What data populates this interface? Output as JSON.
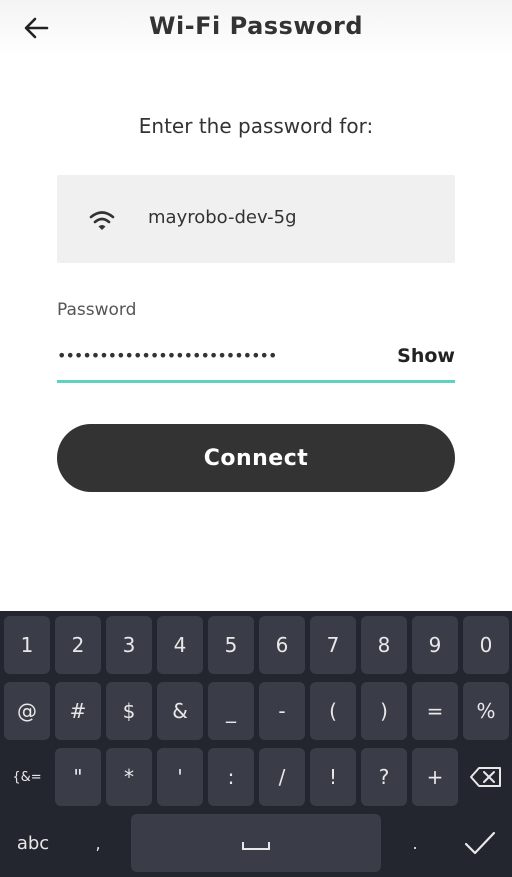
{
  "header": {
    "back_label": "←",
    "title": "Wi-Fi Password"
  },
  "main": {
    "prompt": "Enter the password for:",
    "network": {
      "ssid": "mayrobo-dev-5g"
    },
    "password": {
      "label": "Password",
      "masked_value": "••••••••••••••••••••••••••",
      "show_label": "Show"
    },
    "connect_label": "Connect"
  },
  "keyboard": {
    "row1": [
      "1",
      "2",
      "3",
      "4",
      "5",
      "6",
      "7",
      "8",
      "9",
      "0"
    ],
    "row2": [
      "@",
      "#",
      "$",
      "&",
      "_",
      "-",
      "(",
      ")",
      "=",
      "%"
    ],
    "row3_symbols_label": "{&=",
    "row3": [
      "\"",
      "*",
      "'",
      ":",
      "/",
      "!",
      "?",
      "+"
    ],
    "abc_label": "abc",
    "comma": ",",
    "period": "."
  },
  "colors": {
    "accent": "#5fd3c0",
    "button": "#333333",
    "keyboard_bg": "#23262f",
    "key_bg": "#3a3d47"
  }
}
